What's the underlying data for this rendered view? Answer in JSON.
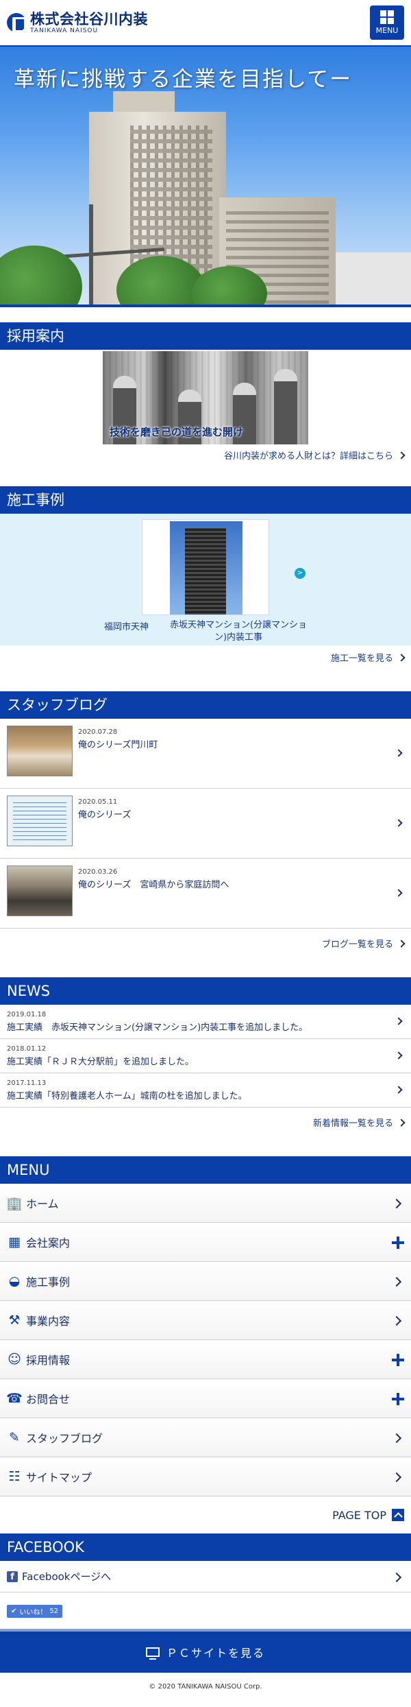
{
  "header": {
    "company_name": "株式会社谷川内装",
    "company_sub": "TANIKAWA NAISOU",
    "menu_label": "MENU"
  },
  "hero": {
    "title": "革新に挑戦する企業を目指してー"
  },
  "recruit": {
    "heading": "採用案内",
    "image_caption": "技術を磨き己の道を進む開け",
    "more": "谷川内装が求める人財とは？詳細はこちら"
  },
  "works": {
    "heading": "施工事例",
    "caption_left": "福岡市天神",
    "caption_right": "赤坂天神マンション(分譲マンション)内装工事",
    "next_label": ">",
    "more": "施工一覧を見る"
  },
  "blog": {
    "heading": "スタッフブログ",
    "items": [
      {
        "date": "2020.07.28",
        "title": "俺のシリーズ門川町"
      },
      {
        "date": "2020.05.11",
        "title": "俺のシリーズ"
      },
      {
        "date": "2020.03.26",
        "title": "俺のシリーズ　宮崎県から家庭訪問へ"
      }
    ],
    "more": "ブログ一覧を見る"
  },
  "news": {
    "heading": "NEWS",
    "items": [
      {
        "date": "2019.01.18",
        "title": "施工実績　赤坂天神マンション(分譲マンション)内装工事を追加しました。"
      },
      {
        "date": "2018.01.12",
        "title": "施工実績「ＲＪＲ大分駅前」を追加しました。"
      },
      {
        "date": "2017.11.13",
        "title": "施工実績「特別養護老人ホーム」城南の杜を追加しました。"
      }
    ],
    "more": "新着情報一覧を見る"
  },
  "menu": {
    "heading": "MENU",
    "items": [
      {
        "label": "ホーム",
        "icon": "building-icon",
        "action": "chevron"
      },
      {
        "label": "会社案内",
        "icon": "grid-icon",
        "action": "plus"
      },
      {
        "label": "施工事例",
        "icon": "helmet-icon",
        "action": "chevron"
      },
      {
        "label": "事業内容",
        "icon": "tools-icon",
        "action": "chevron"
      },
      {
        "label": "採用情報",
        "icon": "user-icon",
        "action": "plus"
      },
      {
        "label": "お問合せ",
        "icon": "phone-icon",
        "action": "plus"
      },
      {
        "label": "スタッフブログ",
        "icon": "pencil-icon",
        "action": "chevron"
      },
      {
        "label": "サイトマップ",
        "icon": "sitemap-icon",
        "action": "chevron"
      }
    ],
    "pagetop": "PAGE TOP"
  },
  "facebook": {
    "heading": "FACEBOOK",
    "link": "Facebookページへ",
    "like_label": "いいね！",
    "like_count": "52"
  },
  "pc_site": "ＰＣサイトを見る",
  "footer": {
    "copyright": "© 2020 TANIKAWA NAISOU Corp."
  },
  "colors": {
    "brand": "#0a3ea8",
    "works_bg": "#dff1fb"
  }
}
